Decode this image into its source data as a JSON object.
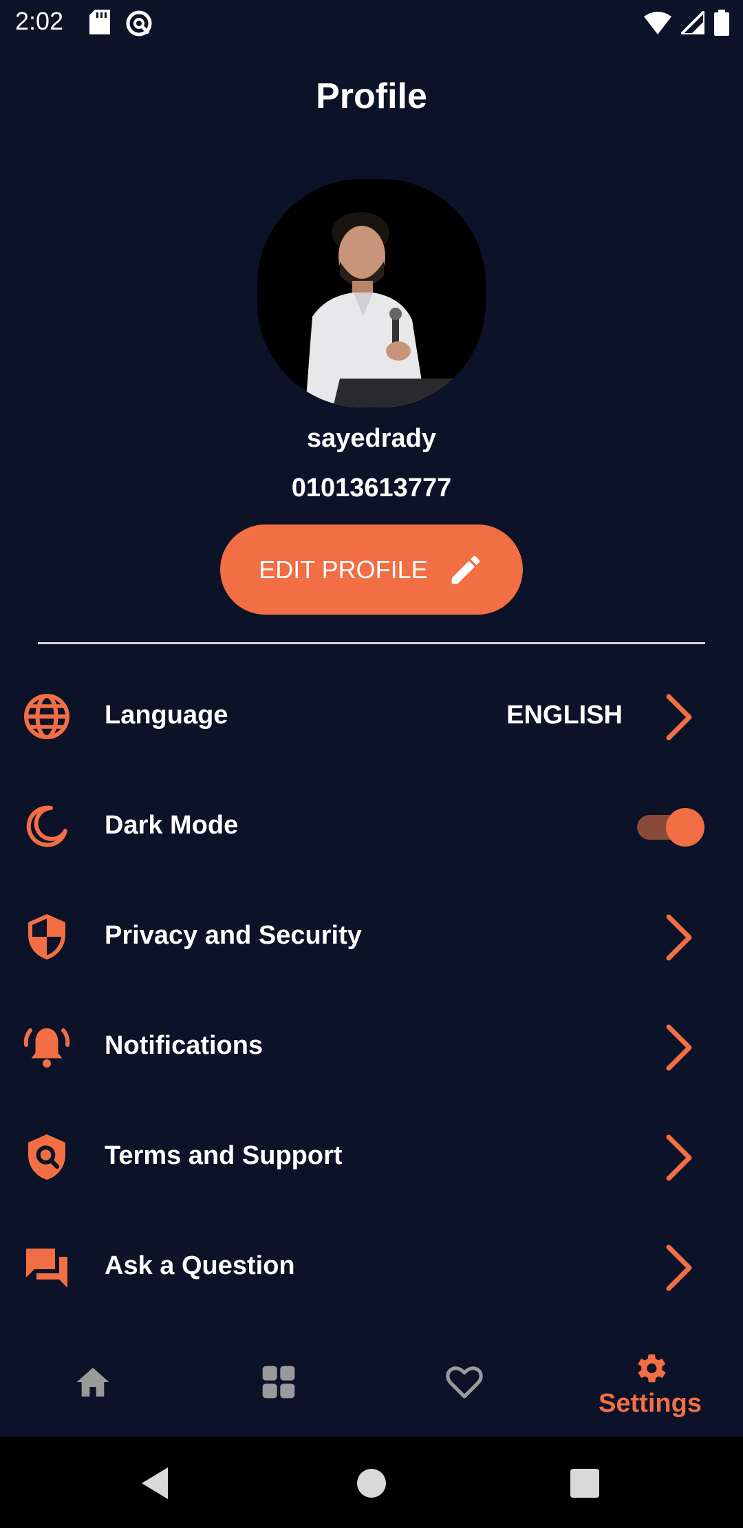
{
  "status_bar": {
    "time": "2:02",
    "left_icons": [
      "sd-card-icon",
      "at-icon"
    ],
    "right_icons": [
      "wifi-icon",
      "signal-icon",
      "battery-icon"
    ]
  },
  "page_title": "Profile",
  "profile": {
    "username": "sayedrady",
    "phone": "01013613777",
    "edit_button_label": "EDIT PROFILE"
  },
  "settings": {
    "language": {
      "label": "Language",
      "value": "ENGLISH",
      "icon": "globe-icon"
    },
    "dark_mode": {
      "label": "Dark Mode",
      "enabled": true,
      "icon": "moon-icon"
    },
    "privacy": {
      "label": "Privacy and Security",
      "icon": "shield-icon"
    },
    "notifications": {
      "label": "Notifications",
      "icon": "bell-icon"
    },
    "terms": {
      "label": "Terms and Support",
      "icon": "search-shield-icon"
    },
    "ask": {
      "label": "Ask a Question",
      "icon": "chat-icon"
    }
  },
  "bottom_nav": {
    "items": [
      {
        "icon": "home-icon",
        "label": ""
      },
      {
        "icon": "grid-icon",
        "label": ""
      },
      {
        "icon": "heart-icon",
        "label": ""
      },
      {
        "icon": "gear-icon",
        "label": "Settings",
        "active": true
      }
    ]
  },
  "colors": {
    "background": "#0c1227",
    "accent": "#f26e45",
    "inactive_icon": "#9a9a9a"
  }
}
